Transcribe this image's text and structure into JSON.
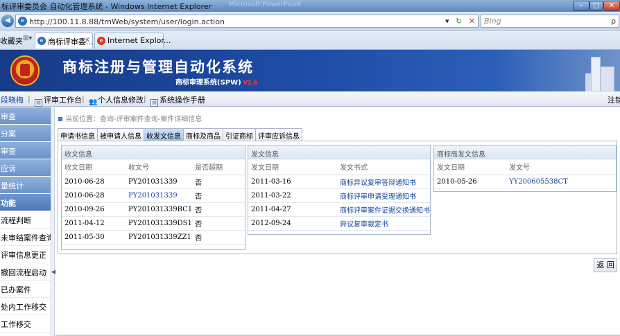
{
  "window": {
    "title": "标评审委员会 自动化管理系统 - Windows Internet Explorer",
    "ghost_title": "Microsoft PowerPoint"
  },
  "address_bar": {
    "url": "http://100.11.8.88/tmWeb/system/user/login.action",
    "search_placeholder": "Bing",
    "search_go": "ρ"
  },
  "favorites_label": "收藏夹",
  "browser_tabs": [
    {
      "label": "商标评审委..."
    },
    {
      "label": "Internet Explor..."
    }
  ],
  "banner": {
    "title": "商标注册与管理自动化系统",
    "subtitle": "商标审理系统(SPW)",
    "version": "V2.6"
  },
  "toolbar": {
    "user": "段晓梅",
    "items": [
      {
        "label": "评审工作台"
      },
      {
        "label": "个人信息修改"
      },
      {
        "label": "系统操作手册"
      }
    ],
    "logout": "注销"
  },
  "sidebar": {
    "items": [
      {
        "label": "审查",
        "kind": "top"
      },
      {
        "label": "分案",
        "kind": "top"
      },
      {
        "label": "审查",
        "kind": "top"
      },
      {
        "label": "应诉",
        "kind": "top"
      },
      {
        "label": "量统计",
        "kind": "top"
      },
      {
        "label": "功能",
        "kind": "group"
      },
      {
        "label": "流程判断",
        "kind": "sub"
      },
      {
        "label": "未审结案件查询",
        "kind": "sub"
      },
      {
        "label": "评审信息更正",
        "kind": "sub"
      },
      {
        "label": "撤回流程启动",
        "kind": "sub"
      },
      {
        "label": "已办案件",
        "kind": "sub"
      },
      {
        "label": "处内工作移交",
        "kind": "sub"
      },
      {
        "label": "工作移交",
        "kind": "sub"
      }
    ]
  },
  "breadcrumb": "当前位置：查询-评审案件查询-案件详细信息",
  "tabs": [
    {
      "label": "申请书信息",
      "active": false
    },
    {
      "label": "被申请人信息",
      "active": false
    },
    {
      "label": "收发文信息",
      "active": true
    },
    {
      "label": "商标及商品",
      "active": false
    },
    {
      "label": "引证商标",
      "active": false
    },
    {
      "label": "评审应诉信息",
      "active": false
    }
  ],
  "receive_panel": {
    "title": "收文信息",
    "columns": [
      "收文日期",
      "收文号",
      "是否超期"
    ],
    "rows": [
      {
        "date": "2010-06-28",
        "no": "PY201031339",
        "overdue": "否",
        "link": false
      },
      {
        "date": "2010-06-28",
        "no": "PY201031339",
        "overdue": "否",
        "link": true
      },
      {
        "date": "2010-09-26",
        "no": "PY201031339BC1",
        "overdue": "否",
        "link": false
      },
      {
        "date": "2011-04-12",
        "no": "PY201031339DS1",
        "overdue": "否",
        "link": false
      },
      {
        "date": "2011-05-30",
        "no": "PY201031339ZZ1",
        "overdue": "否",
        "link": false
      }
    ]
  },
  "send_panel": {
    "title": "发文信息",
    "columns": [
      "发文日期",
      "发文书式"
    ],
    "rows": [
      {
        "date": "2011-03-16",
        "doc": "商标异议复审答辩通知书"
      },
      {
        "date": "2011-03-22",
        "doc": "商标评审申请受理通知书"
      },
      {
        "date": "2011-04-27",
        "doc": "商标评审案件证据交换通知书"
      },
      {
        "date": "2012-09-24",
        "doc": "异议复审裁定书"
      }
    ]
  },
  "office_panel": {
    "title": "商标局发文信息",
    "columns": [
      "发文日期",
      "发文号"
    ],
    "rows": [
      {
        "date": "2010-05-26",
        "no": "YY200605538CT"
      }
    ]
  },
  "return_button": "返 回",
  "colors": {
    "banner": "#1e4ca6",
    "sidebar_item": "#7ea2d3",
    "link": "#1746a0"
  }
}
